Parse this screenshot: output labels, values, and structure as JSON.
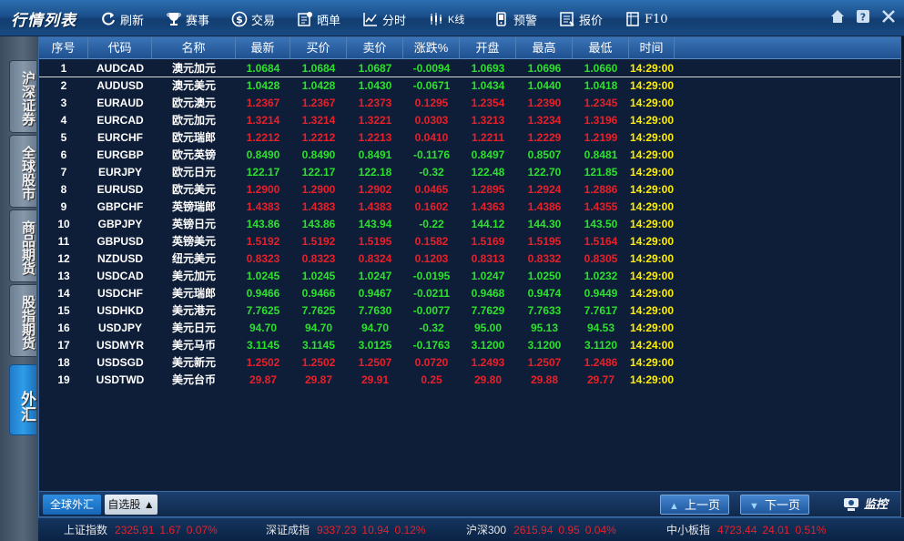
{
  "app": {
    "title": "行情列表"
  },
  "toolbar": [
    {
      "id": "refresh",
      "label": "刷新",
      "icon": "refresh-icon"
    },
    {
      "id": "events",
      "label": "赛事",
      "icon": "trophy-icon"
    },
    {
      "id": "trade",
      "label": "交易",
      "icon": "dollar-icon"
    },
    {
      "id": "share",
      "label": "晒单",
      "icon": "share-icon"
    },
    {
      "id": "minute",
      "label": "分时",
      "icon": "line-chart-icon"
    },
    {
      "id": "kline",
      "label": "K线",
      "icon": "candlestick-icon"
    },
    {
      "id": "alert",
      "label": "预警",
      "icon": "phone-alert-icon"
    },
    {
      "id": "quote",
      "label": "报价",
      "icon": "quote-icon"
    },
    {
      "id": "f10",
      "label": "F10",
      "icon": "document-icon"
    }
  ],
  "sidebar": [
    {
      "label": "沪深证券",
      "active": false
    },
    {
      "label": "全球股市",
      "active": false
    },
    {
      "label": "商品期货",
      "active": false
    },
    {
      "label": "股指期货",
      "active": false
    },
    {
      "label": "外汇",
      "active": true
    }
  ],
  "table": {
    "columns": [
      "序号",
      "代码",
      "名称",
      "最新",
      "买价",
      "卖价",
      "涨跌%",
      "开盘",
      "最高",
      "最低",
      "时间"
    ],
    "rows": [
      {
        "no": "1",
        "code": "AUDCAD",
        "name": "澳元加元",
        "last": "1.0684",
        "bid": "1.0684",
        "ask": "1.0687",
        "chg": "-0.0094",
        "open": "1.0693",
        "high": "1.0696",
        "low": "1.0660",
        "time": "14:29:00",
        "dir": "down"
      },
      {
        "no": "2",
        "code": "AUDUSD",
        "name": "澳元美元",
        "last": "1.0428",
        "bid": "1.0428",
        "ask": "1.0430",
        "chg": "-0.0671",
        "open": "1.0434",
        "high": "1.0440",
        "low": "1.0418",
        "time": "14:29:00",
        "dir": "down"
      },
      {
        "no": "3",
        "code": "EURAUD",
        "name": "欧元澳元",
        "last": "1.2367",
        "bid": "1.2367",
        "ask": "1.2373",
        "chg": "0.1295",
        "open": "1.2354",
        "high": "1.2390",
        "low": "1.2345",
        "time": "14:29:00",
        "dir": "up"
      },
      {
        "no": "4",
        "code": "EURCAD",
        "name": "欧元加元",
        "last": "1.3214",
        "bid": "1.3214",
        "ask": "1.3221",
        "chg": "0.0303",
        "open": "1.3213",
        "high": "1.3234",
        "low": "1.3196",
        "time": "14:29:00",
        "dir": "up"
      },
      {
        "no": "5",
        "code": "EURCHF",
        "name": "欧元瑞郎",
        "last": "1.2212",
        "bid": "1.2212",
        "ask": "1.2213",
        "chg": "0.0410",
        "open": "1.2211",
        "high": "1.2229",
        "low": "1.2199",
        "time": "14:29:00",
        "dir": "up"
      },
      {
        "no": "6",
        "code": "EURGBP",
        "name": "欧元英镑",
        "last": "0.8490",
        "bid": "0.8490",
        "ask": "0.8491",
        "chg": "-0.1176",
        "open": "0.8497",
        "high": "0.8507",
        "low": "0.8481",
        "time": "14:29:00",
        "dir": "down"
      },
      {
        "no": "7",
        "code": "EURJPY",
        "name": "欧元日元",
        "last": "122.17",
        "bid": "122.17",
        "ask": "122.18",
        "chg": "-0.32",
        "open": "122.48",
        "high": "122.70",
        "low": "121.85",
        "time": "14:29:00",
        "dir": "down"
      },
      {
        "no": "8",
        "code": "EURUSD",
        "name": "欧元美元",
        "last": "1.2900",
        "bid": "1.2900",
        "ask": "1.2902",
        "chg": "0.0465",
        "open": "1.2895",
        "high": "1.2924",
        "low": "1.2886",
        "time": "14:29:00",
        "dir": "up"
      },
      {
        "no": "9",
        "code": "GBPCHF",
        "name": "英镑瑞郎",
        "last": "1.4383",
        "bid": "1.4383",
        "ask": "1.4383",
        "chg": "0.1602",
        "open": "1.4363",
        "high": "1.4386",
        "low": "1.4355",
        "time": "14:29:00",
        "dir": "up"
      },
      {
        "no": "10",
        "code": "GBPJPY",
        "name": "英镑日元",
        "last": "143.86",
        "bid": "143.86",
        "ask": "143.94",
        "chg": "-0.22",
        "open": "144.12",
        "high": "144.30",
        "low": "143.50",
        "time": "14:29:00",
        "dir": "down"
      },
      {
        "no": "11",
        "code": "GBPUSD",
        "name": "英镑美元",
        "last": "1.5192",
        "bid": "1.5192",
        "ask": "1.5195",
        "chg": "0.1582",
        "open": "1.5169",
        "high": "1.5195",
        "low": "1.5164",
        "time": "14:29:00",
        "dir": "up"
      },
      {
        "no": "12",
        "code": "NZDUSD",
        "name": "纽元美元",
        "last": "0.8323",
        "bid": "0.8323",
        "ask": "0.8324",
        "chg": "0.1203",
        "open": "0.8313",
        "high": "0.8332",
        "low": "0.8305",
        "time": "14:29:00",
        "dir": "up"
      },
      {
        "no": "13",
        "code": "USDCAD",
        "name": "美元加元",
        "last": "1.0245",
        "bid": "1.0245",
        "ask": "1.0247",
        "chg": "-0.0195",
        "open": "1.0247",
        "high": "1.0250",
        "low": "1.0232",
        "time": "14:29:00",
        "dir": "down"
      },
      {
        "no": "14",
        "code": "USDCHF",
        "name": "美元瑞郎",
        "last": "0.9466",
        "bid": "0.9466",
        "ask": "0.9467",
        "chg": "-0.0211",
        "open": "0.9468",
        "high": "0.9474",
        "low": "0.9449",
        "time": "14:29:00",
        "dir": "down"
      },
      {
        "no": "15",
        "code": "USDHKD",
        "name": "美元港元",
        "last": "7.7625",
        "bid": "7.7625",
        "ask": "7.7630",
        "chg": "-0.0077",
        "open": "7.7629",
        "high": "7.7633",
        "low": "7.7617",
        "time": "14:29:00",
        "dir": "down"
      },
      {
        "no": "16",
        "code": "USDJPY",
        "name": "美元日元",
        "last": "94.70",
        "bid": "94.70",
        "ask": "94.70",
        "chg": "-0.32",
        "open": "95.00",
        "high": "95.13",
        "low": "94.53",
        "time": "14:29:00",
        "dir": "down"
      },
      {
        "no": "17",
        "code": "USDMYR",
        "name": "美元马币",
        "last": "3.1145",
        "bid": "3.1145",
        "ask": "3.0125",
        "chg": "-0.1763",
        "open": "3.1200",
        "high": "3.1200",
        "low": "3.1120",
        "time": "14:24:00",
        "dir": "down"
      },
      {
        "no": "18",
        "code": "USDSGD",
        "name": "美元新元",
        "last": "1.2502",
        "bid": "1.2502",
        "ask": "1.2507",
        "chg": "0.0720",
        "open": "1.2493",
        "high": "1.2507",
        "low": "1.2486",
        "time": "14:29:00",
        "dir": "up"
      },
      {
        "no": "19",
        "code": "USDTWD",
        "name": "美元台币",
        "last": "29.87",
        "bid": "29.87",
        "ask": "29.91",
        "chg": "0.25",
        "open": "29.80",
        "high": "29.88",
        "low": "29.77",
        "time": "14:29:00",
        "dir": "up"
      }
    ]
  },
  "bottom_tabs": {
    "global": "全球外汇",
    "self": "自选股 ▲"
  },
  "pager": {
    "prev": "上一页",
    "next": "下一页"
  },
  "monitor_label": "监控",
  "indices": [
    {
      "name": "上证指数",
      "value": "2325.91",
      "change": "1.67",
      "pct": "0.07%"
    },
    {
      "name": "深证成指",
      "value": "9337.23",
      "change": "10.94",
      "pct": "0.12%"
    },
    {
      "name": "沪深300",
      "value": "2615.94",
      "change": "0.95",
      "pct": "0.04%"
    },
    {
      "name": "中小板指",
      "value": "4723.44",
      "change": "24.01",
      "pct": "0.51%"
    }
  ],
  "colors": {
    "up": "#e8202a",
    "down": "#2de02d",
    "time": "#ffee00",
    "header": "#1f5190"
  }
}
